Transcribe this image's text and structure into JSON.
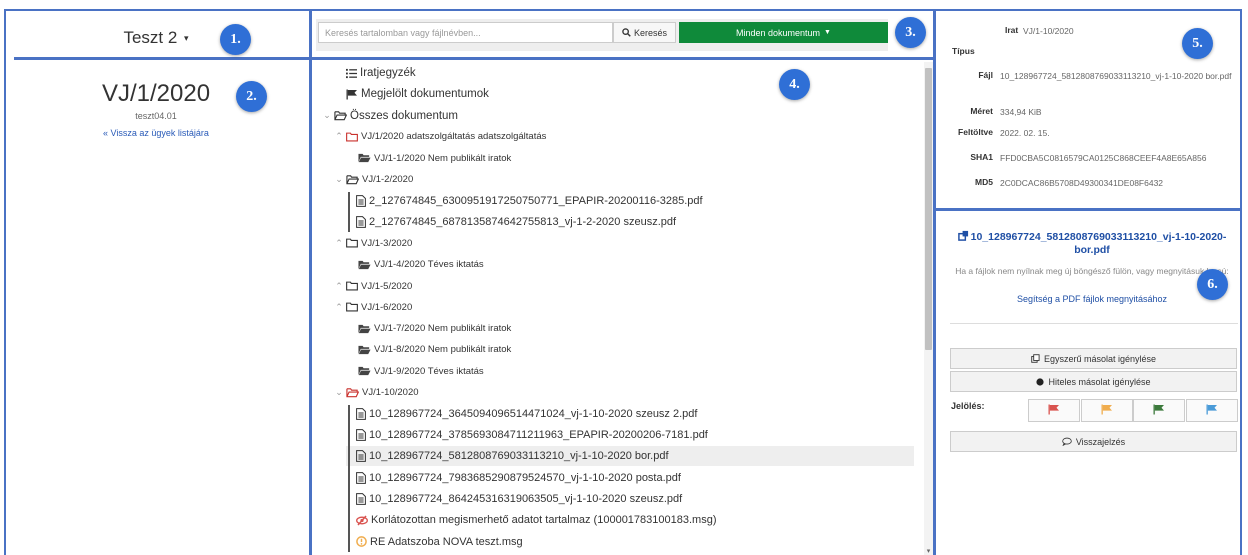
{
  "badges": [
    "1.",
    "2.",
    "3.",
    "4.",
    "5.",
    "6."
  ],
  "left": {
    "case_select": "Teszt 2",
    "case_title": "VJ/1/2020",
    "case_subtitle": "teszt04.01",
    "back_link": "« Vissza az ügyek listájára"
  },
  "toolbar": {
    "search_placeholder": "Keresés tartalomban vagy fájlnévben...",
    "search_button": "Keresés",
    "filter_button": "Minden dokumentum"
  },
  "tree": [
    {
      "label": "Iratjegyzék",
      "icon": "list-icon"
    },
    {
      "label": "Megjelölt dokumentumok",
      "icon": "flag-icon"
    },
    {
      "label": "Összes dokumentum",
      "icon": "folder-open-icon",
      "expanded": true
    },
    {
      "label": "VJ/1/2020 adatszolgáltatás adatszolgáltatás",
      "icon": "folder-icon",
      "color": "#c9302c"
    },
    {
      "label": "VJ/1-1/2020 Nem publikált iratok",
      "icon": "folder-closed-icon"
    },
    {
      "label": "VJ/1-2/2020",
      "icon": "folder-open-icon",
      "expanded": true
    },
    {
      "label": "2_127674845_6300951917250750771_EPAPIR-20200116-3285.pdf",
      "icon": "file-icon"
    },
    {
      "label": "2_127674845_6878135874642755813_vj-1-2-2020 szeusz.pdf",
      "icon": "file-icon"
    },
    {
      "label": "VJ/1-3/2020",
      "icon": "folder-icon"
    },
    {
      "label": "VJ/1-4/2020 Téves iktatás",
      "icon": "folder-closed-icon"
    },
    {
      "label": "VJ/1-5/2020",
      "icon": "folder-icon"
    },
    {
      "label": "VJ/1-6/2020",
      "icon": "folder-icon"
    },
    {
      "label": "VJ/1-7/2020 Nem publikált iratok",
      "icon": "folder-closed-icon"
    },
    {
      "label": "VJ/1-8/2020 Nem publikált iratok",
      "icon": "folder-closed-icon"
    },
    {
      "label": "VJ/1-9/2020 Téves iktatás",
      "icon": "folder-closed-icon"
    },
    {
      "label": "VJ/1-10/2020",
      "icon": "folder-open-icon",
      "expanded": true,
      "color": "#c9302c"
    },
    {
      "label": "10_128967724_3645094096514471024_vj-1-10-2020 szeusz 2.pdf",
      "icon": "file-icon"
    },
    {
      "label": "10_128967724_3785693084711211963_EPAPIR-20200206-7181.pdf",
      "icon": "file-icon"
    },
    {
      "label": "10_128967724_5812808769033113210_vj-1-10-2020 bor.pdf",
      "icon": "file-icon",
      "selected": true
    },
    {
      "label": "10_128967724_7983685290879524570_vj-1-10-2020 posta.pdf",
      "icon": "file-icon"
    },
    {
      "label": "10_128967724_8642453163190635​05_vj-1-10-2020 szeusz.pdf",
      "icon": "file-icon"
    },
    {
      "label": "Korlátozottan megismerhető adatot tartalmaz (100001783100183.msg)",
      "icon": "restricted-icon",
      "color": "#d9534f"
    },
    {
      "label": "RE Adatszoba NOVA teszt.msg",
      "icon": "warning-icon",
      "color": "#f0ad4e"
    }
  ],
  "meta": {
    "irat_label": "Irat",
    "irat_value": "VJ/1-10/2020",
    "tipus_label": "Típus",
    "tipus_value": "",
    "fajl_label": "Fájl",
    "fajl_value": "10_128967724_5812808769033113210_vj-1-10-2020 bor.pdf",
    "meret_label": "Méret",
    "meret_value": "334,94 KiB",
    "feltoltve_label": "Feltöltve",
    "feltoltve_value": "2022. 02. 15.",
    "sha1_label": "SHA1",
    "sha1_value": "FFD0CBA5C0816579CA0125C868CEEF4A8E65A856",
    "md5_label": "MD5",
    "md5_value": "2C0DCAC86B5708D49300341DE08F6432"
  },
  "preview": {
    "file_link": "10_128967724_5812808769033113210_vj-1-10-2020-bor.pdf",
    "note": "Ha a fájlok nem nyílnak meg új böngésző fülön, vagy megnyitásuk lassú:",
    "help_link": "Segítség a PDF fájlok megnyitásához",
    "simple_copy": "Egyszerű másolat igénylése",
    "certified_copy": "Hiteles másolat igénylése",
    "flag_label": "Jelölés:",
    "flags": [
      {
        "icon": "flag-icon",
        "color": "#d9534f"
      },
      {
        "icon": "flag-icon",
        "color": "#f0ad4e"
      },
      {
        "icon": "flag-icon",
        "color": "#3c7a3c"
      },
      {
        "icon": "flag-icon",
        "color": "#4a9bd8"
      }
    ],
    "feedback": "Visszajelzés"
  }
}
